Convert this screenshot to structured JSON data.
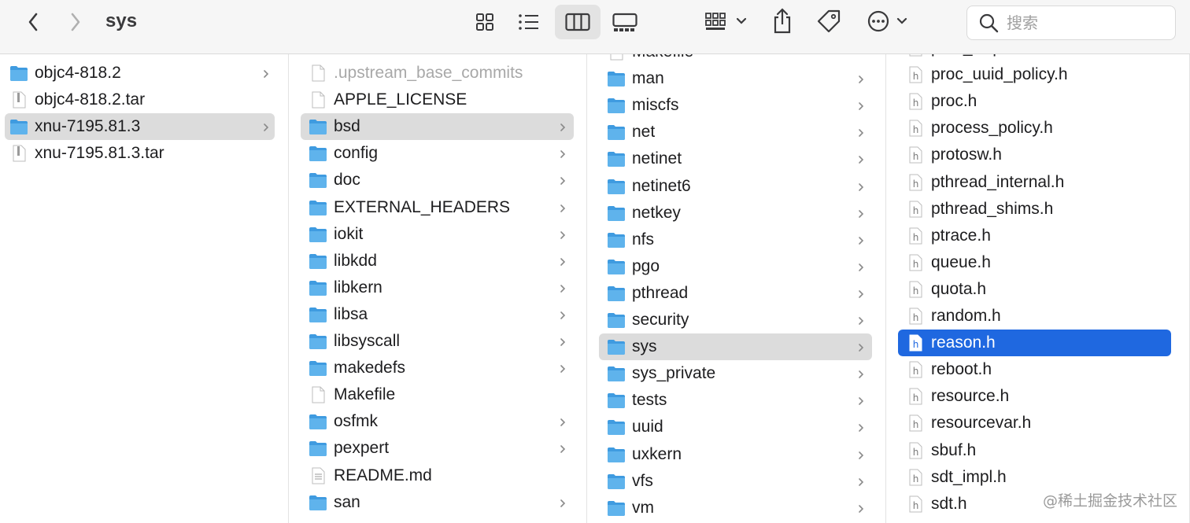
{
  "toolbar": {
    "title": "sys",
    "search_placeholder": "搜索",
    "icons": [
      "back-icon",
      "forward-icon",
      "icon-view-icon",
      "list-view-icon",
      "column-view-icon",
      "gallery-view-icon",
      "group-icon",
      "share-icon",
      "tag-icon",
      "more-icon"
    ]
  },
  "columns": [
    {
      "items": [
        {
          "label": "objc4-818.2",
          "type": "folder",
          "chevron": true
        },
        {
          "label": "objc4-818.2.tar",
          "type": "archive",
          "chevron": false
        },
        {
          "label": "xnu-7195.81.3",
          "type": "folder",
          "chevron": true,
          "selected": "gray"
        },
        {
          "label": "xnu-7195.81.3.tar",
          "type": "archive",
          "chevron": false
        }
      ]
    },
    {
      "items": [
        {
          "label": ".upstream_base_commits",
          "type": "file",
          "chevron": false,
          "dim": true
        },
        {
          "label": "APPLE_LICENSE",
          "type": "file",
          "chevron": false
        },
        {
          "label": "bsd",
          "type": "folder",
          "chevron": true,
          "selected": "gray"
        },
        {
          "label": "config",
          "type": "folder",
          "chevron": true
        },
        {
          "label": "doc",
          "type": "folder",
          "chevron": true
        },
        {
          "label": "EXTERNAL_HEADERS",
          "type": "folder",
          "chevron": true
        },
        {
          "label": "iokit",
          "type": "folder",
          "chevron": true
        },
        {
          "label": "libkdd",
          "type": "folder",
          "chevron": true
        },
        {
          "label": "libkern",
          "type": "folder",
          "chevron": true
        },
        {
          "label": "libsa",
          "type": "folder",
          "chevron": true
        },
        {
          "label": "libsyscall",
          "type": "folder",
          "chevron": true
        },
        {
          "label": "makedefs",
          "type": "folder",
          "chevron": true
        },
        {
          "label": "Makefile",
          "type": "file",
          "chevron": false
        },
        {
          "label": "osfmk",
          "type": "folder",
          "chevron": true
        },
        {
          "label": "pexpert",
          "type": "folder",
          "chevron": true
        },
        {
          "label": "README.md",
          "type": "doc",
          "chevron": false
        },
        {
          "label": "san",
          "type": "folder",
          "chevron": true
        }
      ]
    },
    {
      "items": [
        {
          "label": "Makefile",
          "type": "file",
          "chevron": false,
          "partial": true
        },
        {
          "label": "man",
          "type": "folder",
          "chevron": true
        },
        {
          "label": "miscfs",
          "type": "folder",
          "chevron": true
        },
        {
          "label": "net",
          "type": "folder",
          "chevron": true
        },
        {
          "label": "netinet",
          "type": "folder",
          "chevron": true
        },
        {
          "label": "netinet6",
          "type": "folder",
          "chevron": true
        },
        {
          "label": "netkey",
          "type": "folder",
          "chevron": true
        },
        {
          "label": "nfs",
          "type": "folder",
          "chevron": true
        },
        {
          "label": "pgo",
          "type": "folder",
          "chevron": true
        },
        {
          "label": "pthread",
          "type": "folder",
          "chevron": true
        },
        {
          "label": "security",
          "type": "folder",
          "chevron": true
        },
        {
          "label": "sys",
          "type": "folder",
          "chevron": true,
          "selected": "gray"
        },
        {
          "label": "sys_private",
          "type": "folder",
          "chevron": true
        },
        {
          "label": "tests",
          "type": "folder",
          "chevron": true
        },
        {
          "label": "uuid",
          "type": "folder",
          "chevron": true
        },
        {
          "label": "uxkern",
          "type": "folder",
          "chevron": true
        },
        {
          "label": "vfs",
          "type": "folder",
          "chevron": true
        },
        {
          "label": "vm",
          "type": "folder",
          "chevron": true
        }
      ]
    },
    {
      "items": [
        {
          "label": "proc_reqaro.h",
          "type": "header",
          "chevron": false,
          "partial": true
        },
        {
          "label": "proc_uuid_policy.h",
          "type": "header",
          "chevron": false
        },
        {
          "label": "proc.h",
          "type": "header",
          "chevron": false
        },
        {
          "label": "process_policy.h",
          "type": "header",
          "chevron": false
        },
        {
          "label": "protosw.h",
          "type": "header",
          "chevron": false
        },
        {
          "label": "pthread_internal.h",
          "type": "header",
          "chevron": false
        },
        {
          "label": "pthread_shims.h",
          "type": "header",
          "chevron": false
        },
        {
          "label": "ptrace.h",
          "type": "header",
          "chevron": false
        },
        {
          "label": "queue.h",
          "type": "header",
          "chevron": false
        },
        {
          "label": "quota.h",
          "type": "header",
          "chevron": false
        },
        {
          "label": "random.h",
          "type": "header",
          "chevron": false
        },
        {
          "label": "reason.h",
          "type": "header",
          "chevron": false,
          "selected": "blue"
        },
        {
          "label": "reboot.h",
          "type": "header",
          "chevron": false
        },
        {
          "label": "resource.h",
          "type": "header",
          "chevron": false
        },
        {
          "label": "resourcevar.h",
          "type": "header",
          "chevron": false
        },
        {
          "label": "sbuf.h",
          "type": "header",
          "chevron": false
        },
        {
          "label": "sdt_impl.h",
          "type": "header",
          "chevron": false
        },
        {
          "label": "sdt.h",
          "type": "header",
          "chevron": false
        }
      ]
    }
  ],
  "watermark": "@稀土掘金技术社区",
  "colors": {
    "folder": "#5fb3ec",
    "folder_tab": "#3f9be0",
    "selected_blue": "#1f68e0",
    "selected_gray": "#dcdcdc"
  }
}
